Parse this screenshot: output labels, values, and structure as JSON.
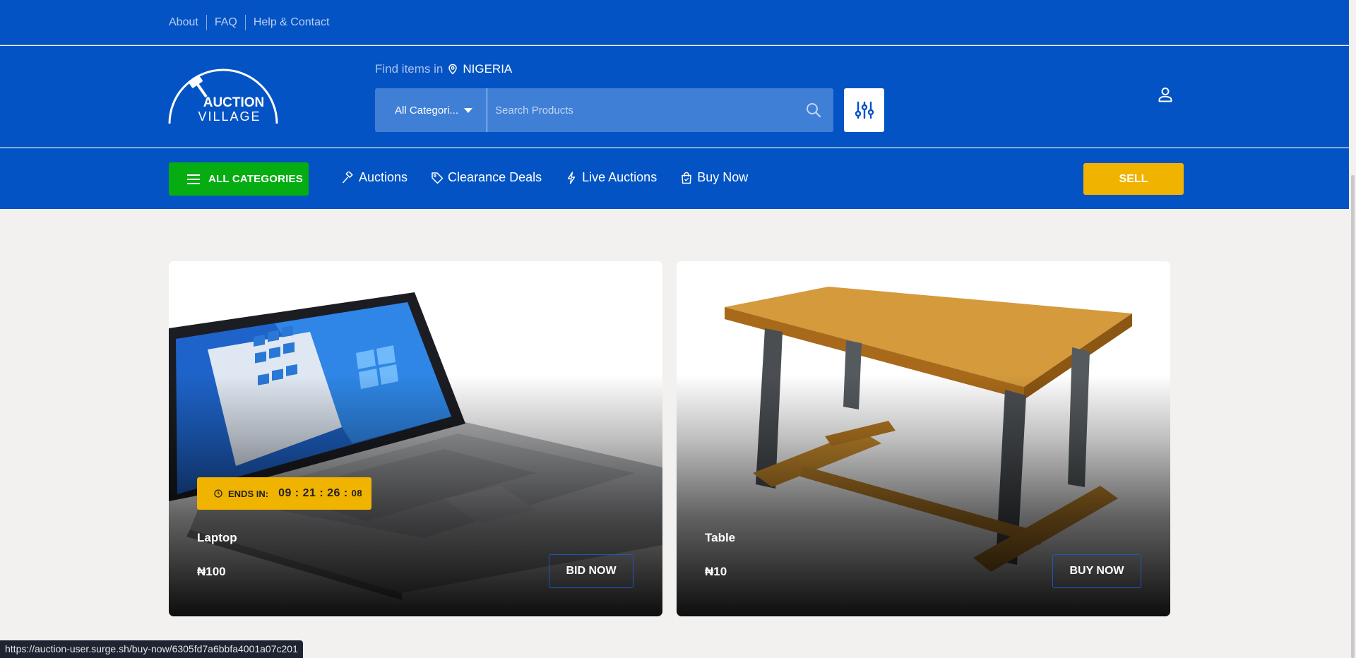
{
  "topbar": {
    "links": [
      "About",
      "FAQ",
      "Help & Contact"
    ]
  },
  "header": {
    "logo_top": "AUCTION",
    "logo_bottom": "VILLAGE",
    "find_label": "Find items in",
    "country": "NIGERIA",
    "category_select": "All Categori...",
    "search_placeholder": "Search Products"
  },
  "nav": {
    "all_categories": "ALL CATEGORIES",
    "links": [
      {
        "label": "Auctions",
        "icon": "gavel-icon"
      },
      {
        "label": "Clearance Deals",
        "icon": "tag-icon"
      },
      {
        "label": "Live Auctions",
        "icon": "lightning-icon"
      },
      {
        "label": "Buy Now",
        "icon": "shopping-bag-icon"
      }
    ],
    "sell": "SELL"
  },
  "products": [
    {
      "title": "Laptop",
      "price": "₦100",
      "action": "BID NOW",
      "ends_label": "ENDS IN:",
      "ends_time_main": "09 : 21 : 26 :",
      "ends_time_sec": "08"
    },
    {
      "title": "Table",
      "price": "₦10",
      "action": "BUY NOW"
    }
  ],
  "status_url": "https://auction-user.surge.sh/buy-now/6305fd7a6bbfa4001a07c201",
  "colors": {
    "primary_blue": "#0353c4",
    "green": "#05ad12",
    "yellow": "#f0b300"
  }
}
